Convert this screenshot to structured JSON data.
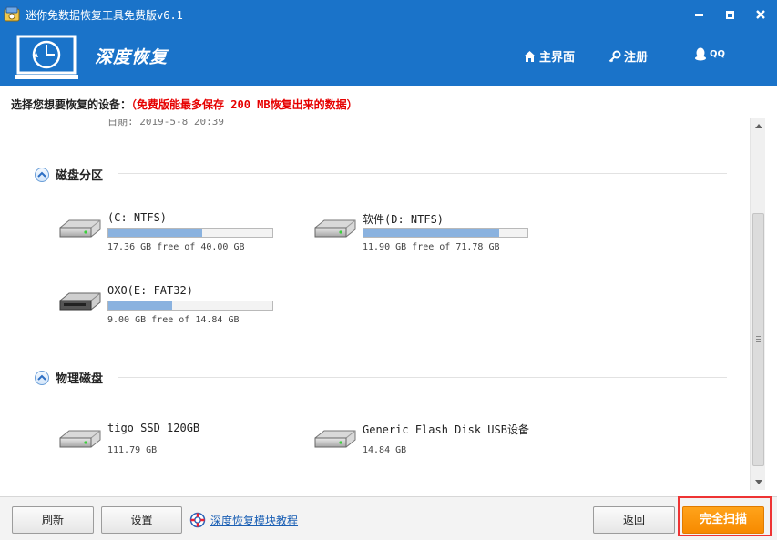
{
  "window": {
    "title": "迷你免数据恢复工具免费版v6.1",
    "buttons": {
      "minimize": "minimize",
      "maximize": "maximize",
      "close": "close"
    }
  },
  "header": {
    "brand": "深度恢复",
    "nav": {
      "home": "主界面",
      "register": "注册",
      "qq": "QQ"
    }
  },
  "colors": {
    "header_bg": "#1a73c9",
    "accent_orange": "#f78a00",
    "progress_fill": "#8ab2df",
    "warning_red": "#e60000"
  },
  "prompt": {
    "label": "选择您想要恢复的设备：",
    "notice": "（免费版能最多保存 200 MB恢复出来的数据）"
  },
  "partial_text": "日期: 2019-5-8 20:39",
  "sections": {
    "partitions": {
      "title": "磁盘分区",
      "drives": [
        {
          "name": "(C: NTFS)",
          "size": "17.36 GB free of 40.00 GB",
          "used_fraction": 0.57,
          "icon": "hard-disk-icon"
        },
        {
          "name": "软件(D: NTFS)",
          "size": "11.90 GB free of 71.78 GB",
          "used_fraction": 0.83,
          "icon": "hard-disk-icon"
        },
        {
          "name": "OXO(E: FAT32)",
          "size": "9.00 GB free of 14.84 GB",
          "used_fraction": 0.39,
          "icon": "removable-disk-icon"
        }
      ]
    },
    "physical": {
      "title": "物理磁盘",
      "disks": [
        {
          "name": "tigo SSD 120GB",
          "size": "111.79 GB",
          "icon": "hard-disk-icon"
        },
        {
          "name": "Generic Flash Disk USB设备",
          "size": "14.84 GB",
          "icon": "hard-disk-icon"
        }
      ]
    }
  },
  "footer": {
    "refresh": "刷新",
    "settings": "设置",
    "tutorial": "深度恢复模块教程",
    "back": "返回",
    "full_scan": "完全扫描"
  }
}
